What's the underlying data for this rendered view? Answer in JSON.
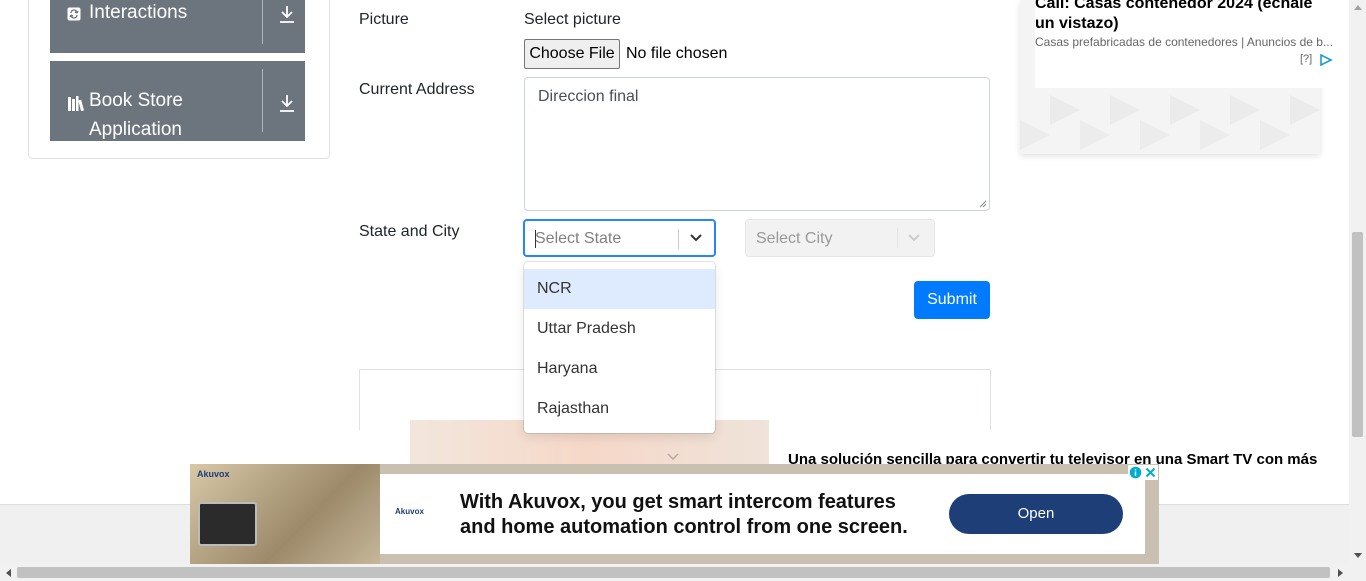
{
  "sidebar": {
    "groups": [
      {
        "label": "Interactions",
        "icon": "interactions-icon"
      },
      {
        "label_line1": "Book Store",
        "label_line2": "Application",
        "icon": "book-icon"
      }
    ]
  },
  "form": {
    "picture_label": "Picture",
    "picture_hint": "Select picture",
    "choose_file_label": "Choose File",
    "file_status": "No file chosen",
    "address_label": "Current Address",
    "address_value": "Direccion final",
    "state_city_label": "State and City",
    "state_placeholder": "Select State",
    "city_placeholder": "Select City",
    "submit_label": "Submit",
    "state_options": [
      "NCR",
      "Uttar Pradesh",
      "Haryana",
      "Rajasthan"
    ],
    "focused_option": "NCR"
  },
  "ads": {
    "right_title": "Call: Casas contenedor 2024 (échale un vistazo)",
    "right_subtitle": "Casas prefabricadas de contenedores | Anuncios de b...",
    "right_marker": "[?]",
    "inline_headline": "Una solución sencilla para convertir tu televisor en una Smart TV con más",
    "banner_brand": "Akuvox",
    "banner_text_line1": "With Akuvox, you get smart intercom features",
    "banner_text_line2": "and home automation control from one screen.",
    "banner_cta": "Open"
  },
  "colors": {
    "accent": "#007bff",
    "select_focus": "#2684ff",
    "option_focus": "#deebff",
    "sidebar_header": "#6c757d",
    "banner_button": "#1e3e78"
  }
}
